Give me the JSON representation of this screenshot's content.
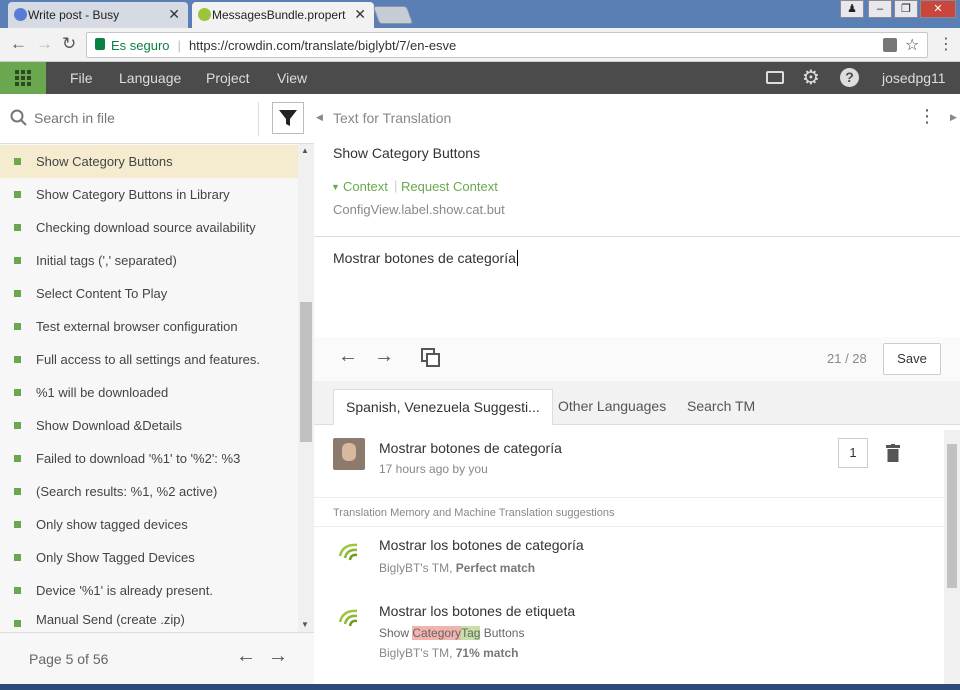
{
  "browser": {
    "tabs": [
      {
        "title": "Write post - Busy"
      },
      {
        "title": "MessagesBundle.propert",
        "close": "✕"
      }
    ],
    "tab0_close": "✕",
    "address": {
      "secure_label": "Es seguro",
      "url": "https://crowdin.com/translate/biglybt/7/en-esve"
    }
  },
  "menubar": {
    "items": [
      "File",
      "Language",
      "Project",
      "View"
    ],
    "user": "josedpg11"
  },
  "left": {
    "search_placeholder": "Search in file",
    "strings": [
      "Show Category Buttons",
      "Show Category Buttons in Library",
      "Checking download source availability",
      "Initial tags (',' separated)",
      "Select Content To Play",
      "Test external browser configuration",
      "Full access to all settings and features.",
      "%1 will be downloaded",
      "Show Download &Details",
      "Failed to download '%1' to '%2': %3",
      "(Search results: %1, %2 active)",
      "Only show tagged devices",
      "Only Show Tagged Devices",
      "Device '%1' is already present.",
      "Manual Send (create .zip)"
    ],
    "page_label": "Page 5 of 56"
  },
  "source": {
    "header": "Text for Translation",
    "text": "Show Category Buttons",
    "context_label": "Context",
    "request_context": "Request Context",
    "key": "ConfigView.label.show.cat.but"
  },
  "translation": {
    "value": "Mostrar botones de categoría"
  },
  "toolbar": {
    "counter": "21 / 28",
    "save_label": "Save"
  },
  "suggestion_tabs": [
    "Spanish, Venezuela Suggesti...",
    "Other Languages",
    "Search TM"
  ],
  "user_suggestion": {
    "text": "Mostrar botones de categoría",
    "meta": "17 hours ago by you",
    "votes": "1"
  },
  "tm": {
    "header": "Translation Memory and Machine Translation suggestions",
    "items": [
      {
        "text": "Mostrar los botones de categoría",
        "source_prefix": "",
        "meta_prefix": "BiglyBT's TM, ",
        "meta_match": "Perfect match"
      },
      {
        "text": "Mostrar los botones de etiqueta",
        "source_prefix": "Show ",
        "source_del": "Category",
        "source_ins": "Tag",
        "source_suffix": " Buttons",
        "meta_prefix": "BiglyBT's TM, ",
        "meta_match": "71% match"
      }
    ]
  },
  "colors": {
    "accent_green": "#6aa84f",
    "selected_row": "#f5ecd0",
    "menubar": "#4b4b4b"
  }
}
